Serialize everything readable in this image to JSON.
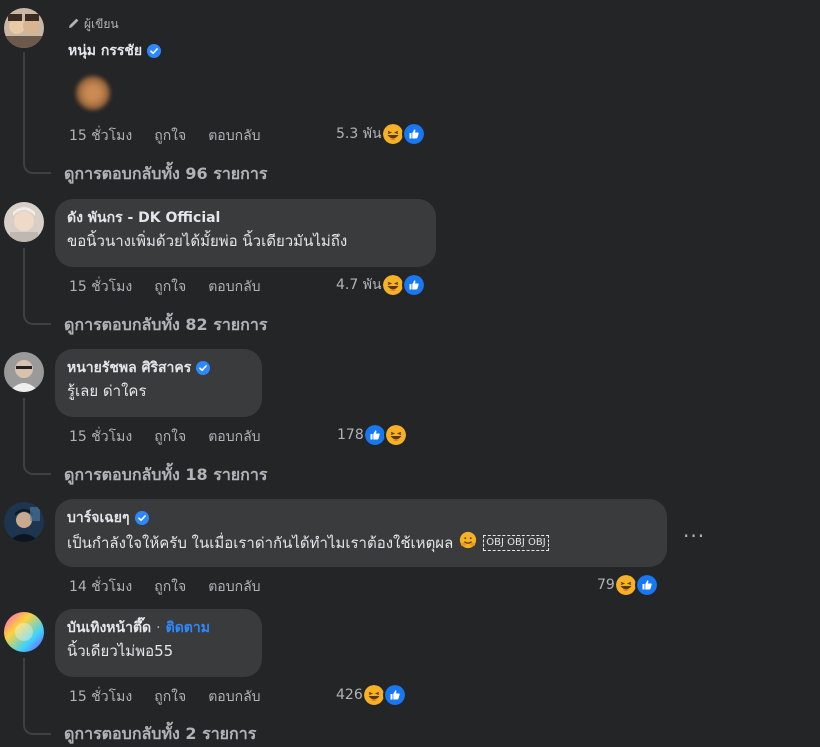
{
  "author_tag": "ผู้เขียน",
  "comments": [
    {
      "name": "หนุ่ม กรรชัย",
      "verified": true,
      "text": "",
      "time": "15 ชั่วโมง",
      "like": "ถูกใจ",
      "reply": "ตอบกลับ",
      "reactions": "5.3 พัน",
      "reaction_icons": [
        "haha-icon",
        "like-icon"
      ],
      "view_replies": "ดูการตอบกลับทั้ง 96 รายการ"
    },
    {
      "name": "ดัง พันกร - DK Official",
      "verified": false,
      "text": "ขอนิ้วนางเพิ่มด้วยได้มั้ยพ่อ นิ้วเดียวมันไม่ถึง",
      "time": "15 ชั่วโมง",
      "like": "ถูกใจ",
      "reply": "ตอบกลับ",
      "reactions": "4.7 พัน",
      "reaction_icons": [
        "haha-icon",
        "like-icon"
      ],
      "view_replies": "ดูการตอบกลับทั้ง 82 รายการ"
    },
    {
      "name": "หนายรัชพล ศิริสาคร",
      "verified": true,
      "text": "รู้เลย ด่าใคร",
      "time": "15 ชั่วโมง",
      "like": "ถูกใจ",
      "reply": "ตอบกลับ",
      "reactions": "178",
      "reaction_icons": [
        "like-icon",
        "haha-icon"
      ],
      "view_replies": "ดูการตอบกลับทั้ง 18 รายการ"
    },
    {
      "name": "บาร์จเฉยๆ",
      "verified": true,
      "text": "เป็นกำลังใจให้ครับ ในเมื่อเราด่ากันได้ทำไมเราต้องใช้เหตุผล",
      "emoji_tail": "OBJ OBJ OBJ",
      "time": "14 ชั่วโมง",
      "like": "ถูกใจ",
      "reply": "ตอบกลับ",
      "reactions": "79",
      "reaction_icons": [
        "haha-icon",
        "like-icon"
      ],
      "more": "···"
    },
    {
      "name": "บันเทิงหน้าตึ๊ด",
      "verified": false,
      "follow_sep": "·",
      "follow": "ติดตาม",
      "text": "นิ้วเดียวไม่พอ55",
      "time": "15 ชั่วโมง",
      "like": "ถูกใจ",
      "reply": "ตอบกลับ",
      "reactions": "426",
      "reaction_icons": [
        "haha-icon",
        "like-icon"
      ],
      "view_replies": "ดูการตอบกลับทั้ง 2 รายการ"
    }
  ],
  "colors": {
    "background": "#242526",
    "bubble": "#3a3b3c",
    "link": "#2d88ff",
    "like": "#1877f2",
    "haha": "#f7b125"
  }
}
